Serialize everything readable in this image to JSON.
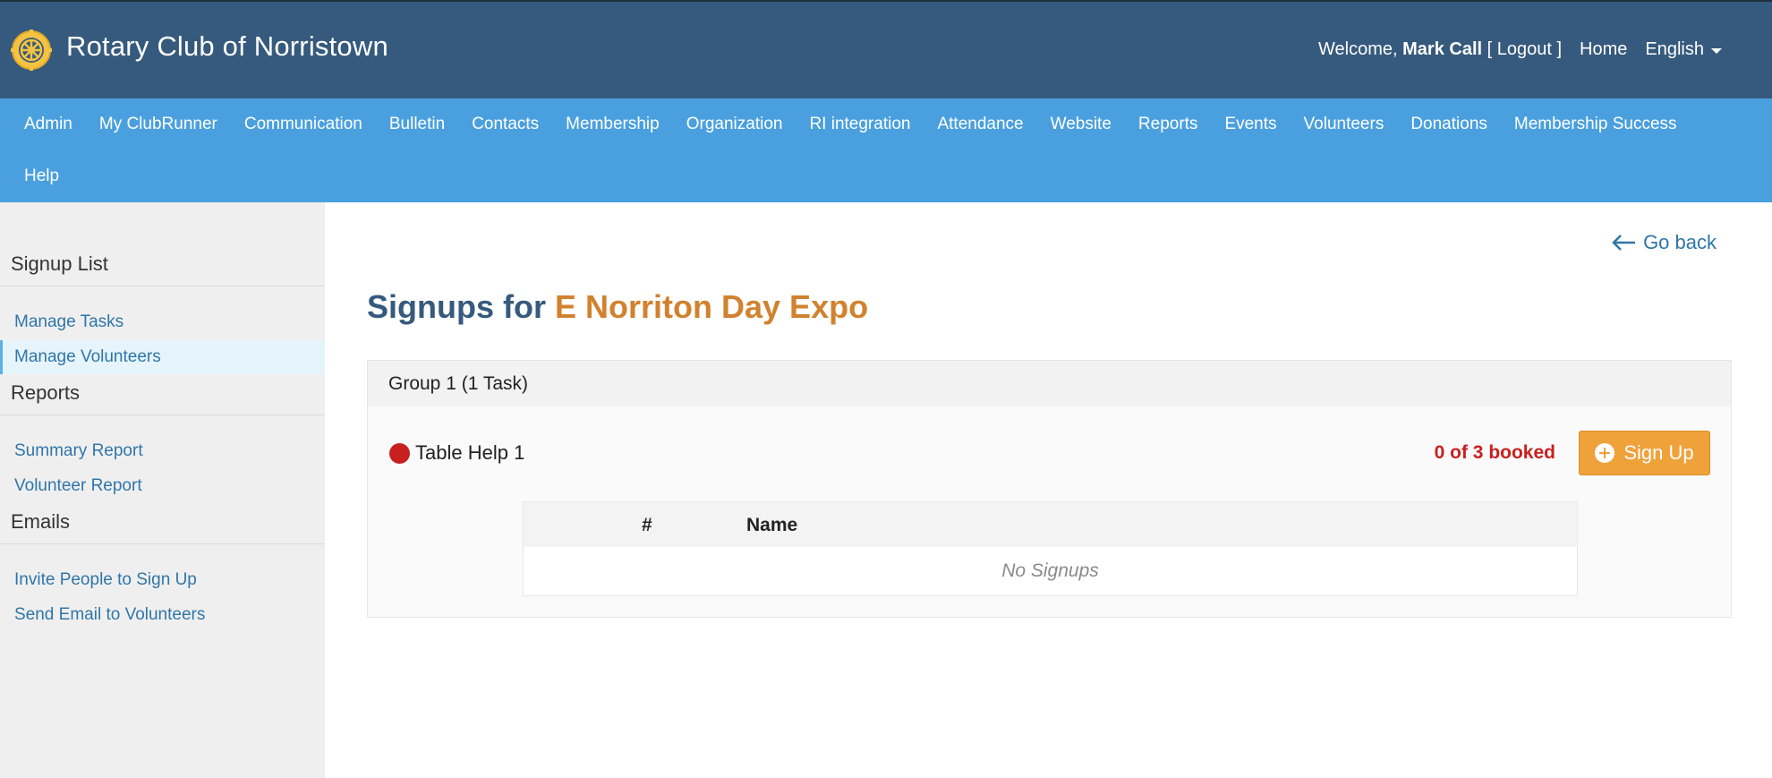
{
  "header": {
    "club_name": "Rotary Club of Norristown",
    "welcome_prefix": "Welcome,",
    "user_name": "Mark Call",
    "logout": "[ Logout ]",
    "home": "Home",
    "language": "English"
  },
  "nav": {
    "row1": [
      "Admin",
      "My ClubRunner",
      "Communication",
      "Bulletin",
      "Contacts",
      "Membership",
      "Organization",
      "RI integration",
      "Attendance",
      "Website",
      "Reports",
      "Events",
      "Volunteers",
      "Donations",
      "Membership Success"
    ],
    "row2": [
      "Help"
    ]
  },
  "sidebar": {
    "sections": [
      {
        "title": "Signup List",
        "items": [
          "Manage Tasks",
          "Manage Volunteers"
        ]
      },
      {
        "title": "Reports",
        "items": [
          "Summary Report",
          "Volunteer Report"
        ]
      },
      {
        "title": "Emails",
        "items": [
          "Invite People to Sign Up",
          "Send Email to Volunteers"
        ]
      }
    ],
    "active_item": "Manage Volunteers"
  },
  "main": {
    "go_back": "Go back",
    "title_prefix": "Signups for",
    "event_name": "E Norriton Day Expo",
    "group": {
      "header": "Group 1 (1 Task)",
      "task": {
        "name": "Table Help 1",
        "booked": "0 of 3 booked",
        "signup_label": "Sign Up"
      },
      "table": {
        "columns": [
          "#",
          "Name"
        ],
        "empty_text": "No Signups"
      }
    }
  },
  "colors": {
    "header_bg": "#365a7d",
    "nav_bg": "#4aa0df",
    "accent_orange": "#d1822e",
    "button_orange": "#efa23a",
    "status_red": "#c8201e",
    "link_blue": "#2f76a8"
  }
}
